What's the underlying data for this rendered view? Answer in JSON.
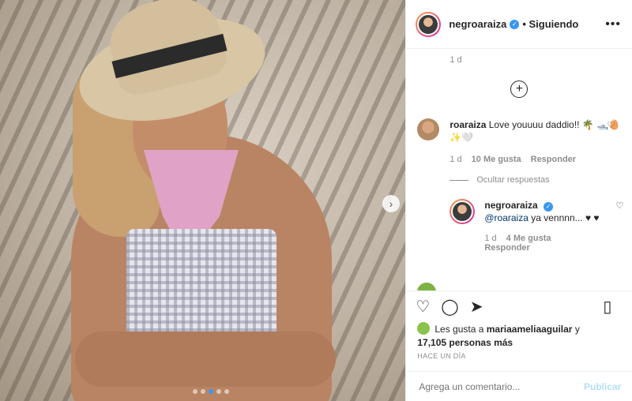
{
  "post": {
    "username": "negroaraiza",
    "follow_status": "Siguiendo",
    "more_icon": "more-dots-icon",
    "carousel_dots": 5,
    "active_dot": 3
  },
  "comments": {
    "top_time": "1 d",
    "items": [
      {
        "username": "roaraiza",
        "text": "Love youuuu daddio!! 🌴 🛥️🥚✨🤍",
        "time": "1 d",
        "likes": "10 Me gusta",
        "reply": "Responder"
      }
    ],
    "hide_replies": "Ocultar respuestas",
    "replies": [
      {
        "username": "negroaraiza",
        "mention": "@roaraiza",
        "text": " ya vennnn... ♥ ♥",
        "time": "1 d",
        "likes": "4 Me gusta",
        "reply": "Responder"
      }
    ]
  },
  "likes": {
    "prefix": "Les gusta a",
    "user": "mariaameliaaguilar",
    "middle": "y",
    "count": "17,105 personas más"
  },
  "posted_ago": "HACE UN DÍA",
  "add_comment": {
    "placeholder": "Agrega un comentario...",
    "publish": "Publicar"
  }
}
